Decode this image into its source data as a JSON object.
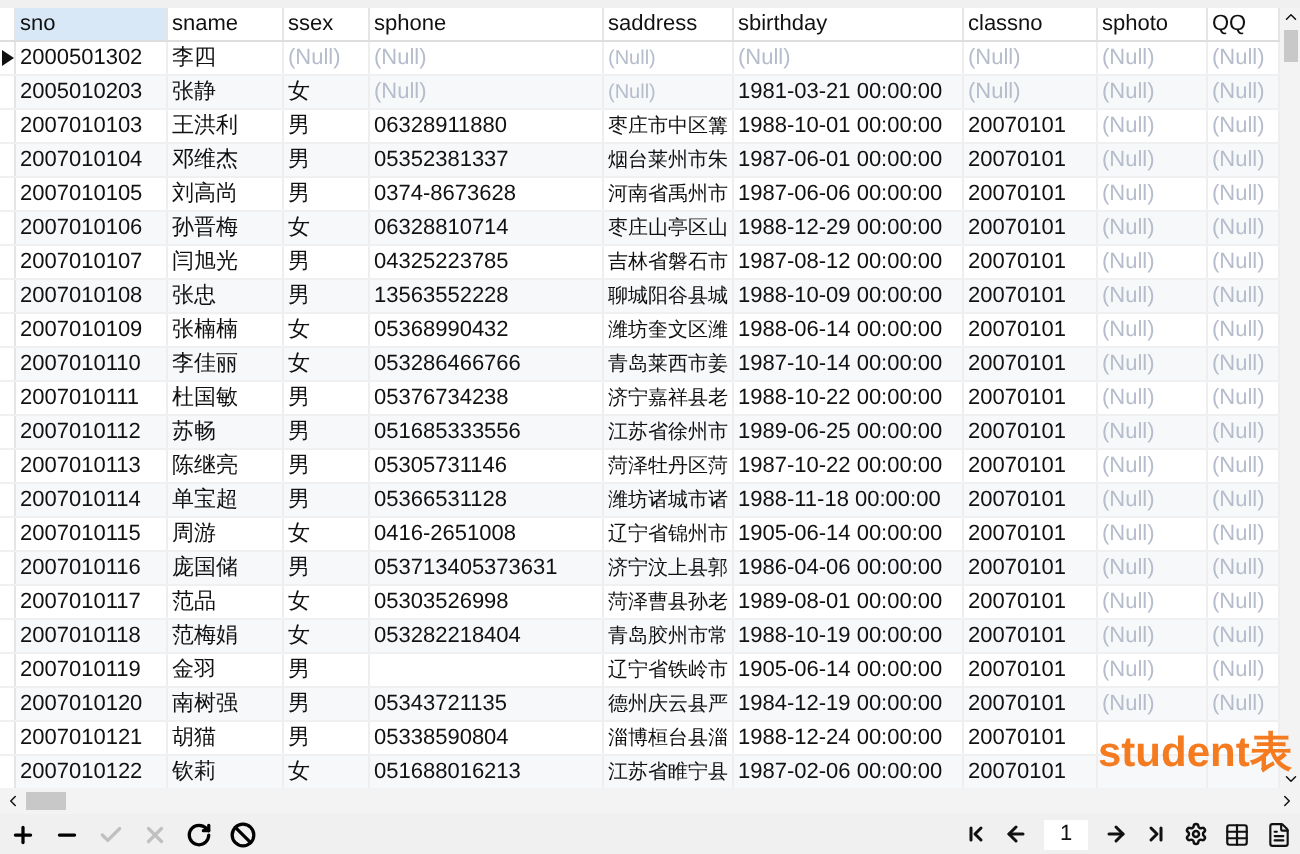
{
  "columns": [
    {
      "label": "sno",
      "selected": true
    },
    {
      "label": "sname",
      "selected": false
    },
    {
      "label": "ssex",
      "selected": false
    },
    {
      "label": "sphone",
      "selected": false
    },
    {
      "label": "saddress",
      "selected": false
    },
    {
      "label": "sbirthday",
      "selected": false
    },
    {
      "label": "classno",
      "selected": false
    },
    {
      "label": "sphoto",
      "selected": false
    },
    {
      "label": "QQ",
      "selected": false
    }
  ],
  "rows": [
    {
      "selected": true,
      "cells": [
        "2000501302",
        "李四",
        {
          "text": "(Null)",
          "is_null": true
        },
        {
          "text": "(Null)",
          "is_null": true
        },
        {
          "text": "(Null)",
          "is_null": true
        },
        {
          "text": "(Null)",
          "is_null": true
        },
        {
          "text": "(Null)",
          "is_null": true
        },
        {
          "text": "(Null)",
          "is_null": true
        },
        {
          "text": "(Null)",
          "is_null": true
        }
      ]
    },
    {
      "selected": false,
      "cells": [
        "2005010203",
        "张静",
        "女",
        {
          "text": "(Null)",
          "is_null": true
        },
        {
          "text": "(Null)",
          "is_null": true
        },
        "1981-03-21 00:00:00",
        {
          "text": "(Null)",
          "is_null": true
        },
        {
          "text": "(Null)",
          "is_null": true
        },
        {
          "text": "(Null)",
          "is_null": true
        }
      ]
    },
    {
      "selected": false,
      "cells": [
        "2007010103",
        "王洪利",
        "男",
        "06328911880",
        "枣庄市中区篝",
        "1988-10-01 00:00:00",
        "20070101",
        {
          "text": "(Null)",
          "is_null": true
        },
        {
          "text": "(Null)",
          "is_null": true
        }
      ]
    },
    {
      "selected": false,
      "cells": [
        "2007010104",
        "邓维杰",
        "男",
        "05352381337",
        "烟台莱州市朱",
        "1987-06-01 00:00:00",
        "20070101",
        {
          "text": "(Null)",
          "is_null": true
        },
        {
          "text": "(Null)",
          "is_null": true
        }
      ]
    },
    {
      "selected": false,
      "cells": [
        "2007010105",
        "刘高尚",
        "男",
        "0374-8673628",
        "河南省禹州市",
        "1987-06-06 00:00:00",
        "20070101",
        {
          "text": "(Null)",
          "is_null": true
        },
        {
          "text": "(Null)",
          "is_null": true
        }
      ]
    },
    {
      "selected": false,
      "cells": [
        "2007010106",
        "孙晋梅",
        "女",
        "06328810714",
        "枣庄山亭区山",
        "1988-12-29 00:00:00",
        "20070101",
        {
          "text": "(Null)",
          "is_null": true
        },
        {
          "text": "(Null)",
          "is_null": true
        }
      ]
    },
    {
      "selected": false,
      "cells": [
        "2007010107",
        "闫旭光",
        "男",
        "04325223785",
        "吉林省磐石市",
        "1987-08-12 00:00:00",
        "20070101",
        {
          "text": "(Null)",
          "is_null": true
        },
        {
          "text": "(Null)",
          "is_null": true
        }
      ]
    },
    {
      "selected": false,
      "cells": [
        "2007010108",
        "张忠",
        "男",
        "13563552228",
        "聊城阳谷县城",
        "1988-10-09 00:00:00",
        "20070101",
        {
          "text": "(Null)",
          "is_null": true
        },
        {
          "text": "(Null)",
          "is_null": true
        }
      ]
    },
    {
      "selected": false,
      "cells": [
        "2007010109",
        "张楠楠",
        "女",
        "05368990432",
        "潍坊奎文区潍",
        "1988-06-14 00:00:00",
        "20070101",
        {
          "text": "(Null)",
          "is_null": true
        },
        {
          "text": "(Null)",
          "is_null": true
        }
      ]
    },
    {
      "selected": false,
      "cells": [
        "2007010110",
        "李佳丽",
        "女",
        "053286466766",
        "青岛莱西市姜",
        "1987-10-14 00:00:00",
        "20070101",
        {
          "text": "(Null)",
          "is_null": true
        },
        {
          "text": "(Null)",
          "is_null": true
        }
      ]
    },
    {
      "selected": false,
      "cells": [
        "2007010111",
        "杜国敏",
        "男",
        "05376734238",
        "济宁嘉祥县老",
        "1988-10-22 00:00:00",
        "20070101",
        {
          "text": "(Null)",
          "is_null": true
        },
        {
          "text": "(Null)",
          "is_null": true
        }
      ]
    },
    {
      "selected": false,
      "cells": [
        "2007010112",
        "苏畅",
        "男",
        "051685333556",
        "江苏省徐州市",
        "1989-06-25 00:00:00",
        "20070101",
        {
          "text": "(Null)",
          "is_null": true
        },
        {
          "text": "(Null)",
          "is_null": true
        }
      ]
    },
    {
      "selected": false,
      "cells": [
        "2007010113",
        "陈继亮",
        "男",
        "05305731146",
        "菏泽牡丹区菏",
        "1987-10-22 00:00:00",
        "20070101",
        {
          "text": "(Null)",
          "is_null": true
        },
        {
          "text": "(Null)",
          "is_null": true
        }
      ]
    },
    {
      "selected": false,
      "cells": [
        "2007010114",
        "单宝超",
        "男",
        "05366531128",
        "潍坊诸城市诸",
        "1988-11-18 00:00:00",
        "20070101",
        {
          "text": "(Null)",
          "is_null": true
        },
        {
          "text": "(Null)",
          "is_null": true
        }
      ]
    },
    {
      "selected": false,
      "cells": [
        "2007010115",
        "周游",
        "女",
        "0416-2651008",
        "辽宁省锦州市",
        "1905-06-14 00:00:00",
        "20070101",
        {
          "text": "(Null)",
          "is_null": true
        },
        {
          "text": "(Null)",
          "is_null": true
        }
      ]
    },
    {
      "selected": false,
      "cells": [
        "2007010116",
        "庞国储",
        "男",
        "053713405373631",
        "济宁汶上县郭",
        "1986-04-06 00:00:00",
        "20070101",
        {
          "text": "(Null)",
          "is_null": true
        },
        {
          "text": "(Null)",
          "is_null": true
        }
      ]
    },
    {
      "selected": false,
      "cells": [
        "2007010117",
        "范品",
        "女",
        "05303526998",
        "菏泽曹县孙老",
        "1989-08-01 00:00:00",
        "20070101",
        {
          "text": "(Null)",
          "is_null": true
        },
        {
          "text": "(Null)",
          "is_null": true
        }
      ]
    },
    {
      "selected": false,
      "cells": [
        "2007010118",
        "范梅娟",
        "女",
        "053282218404",
        "青岛胶州市常",
        "1988-10-19 00:00:00",
        "20070101",
        {
          "text": "(Null)",
          "is_null": true
        },
        {
          "text": "(Null)",
          "is_null": true
        }
      ]
    },
    {
      "selected": false,
      "cells": [
        "2007010119",
        "金羽",
        "男",
        null,
        "辽宁省铁岭市",
        "1905-06-14 00:00:00",
        "20070101",
        {
          "text": "(Null)",
          "is_null": true
        },
        {
          "text": "(Null)",
          "is_null": true
        }
      ]
    },
    {
      "selected": false,
      "cells": [
        "2007010120",
        "南树强",
        "男",
        "05343721135",
        "德州庆云县严",
        "1984-12-19 00:00:00",
        "20070101",
        {
          "text": "(Null)",
          "is_null": true
        },
        {
          "text": "(Null)",
          "is_null": true
        }
      ]
    },
    {
      "selected": false,
      "cells": [
        "2007010121",
        "胡猫",
        "男",
        "05338590804",
        "淄博桓台县淄",
        "1988-12-24 00:00:00",
        "20070101",
        null,
        null
      ]
    },
    {
      "selected": false,
      "cells": [
        "2007010122",
        "钦莉",
        "女",
        "051688016213",
        "江苏省睢宁县",
        "1987-02-06 00:00:00",
        "20070101",
        null,
        null
      ]
    }
  ],
  "overlay_label": "student表",
  "toolbar_left": [
    {
      "kind": "add",
      "disabled": false
    },
    {
      "kind": "delete",
      "disabled": false
    },
    {
      "kind": "apply",
      "disabled": true
    },
    {
      "kind": "discard",
      "disabled": true
    },
    {
      "kind": "refresh",
      "disabled": false
    },
    {
      "kind": "stop",
      "disabled": false
    }
  ],
  "pager": {
    "page": "1"
  }
}
